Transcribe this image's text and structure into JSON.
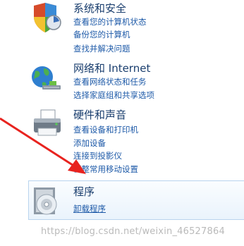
{
  "categories": [
    {
      "title": "系统和安全",
      "links": [
        "查看您的计算机状态",
        "备份您的计算机",
        "查找并解决问题"
      ],
      "icon": "shield-icon"
    },
    {
      "title": "网络和 Internet",
      "links": [
        "查看网络状态和任务",
        "选择家庭组和共享选项"
      ],
      "icon": "network-globe-icon"
    },
    {
      "title": "硬件和声音",
      "links": [
        "查看设备和打印机",
        "添加设备",
        "连接到投影仪",
        "调整常用移动设置"
      ],
      "icon": "printer-icon"
    },
    {
      "title": "程序",
      "links": [
        "卸载程序"
      ],
      "icon": "programs-disc-icon"
    }
  ],
  "watermark": "https://blog.csdn.net/weixin_46527864",
  "colors": {
    "title": "#1a3e6e",
    "link": "#1e5aa8",
    "arrow": "#e8231f",
    "highlight_border": "#b9d4ee"
  }
}
